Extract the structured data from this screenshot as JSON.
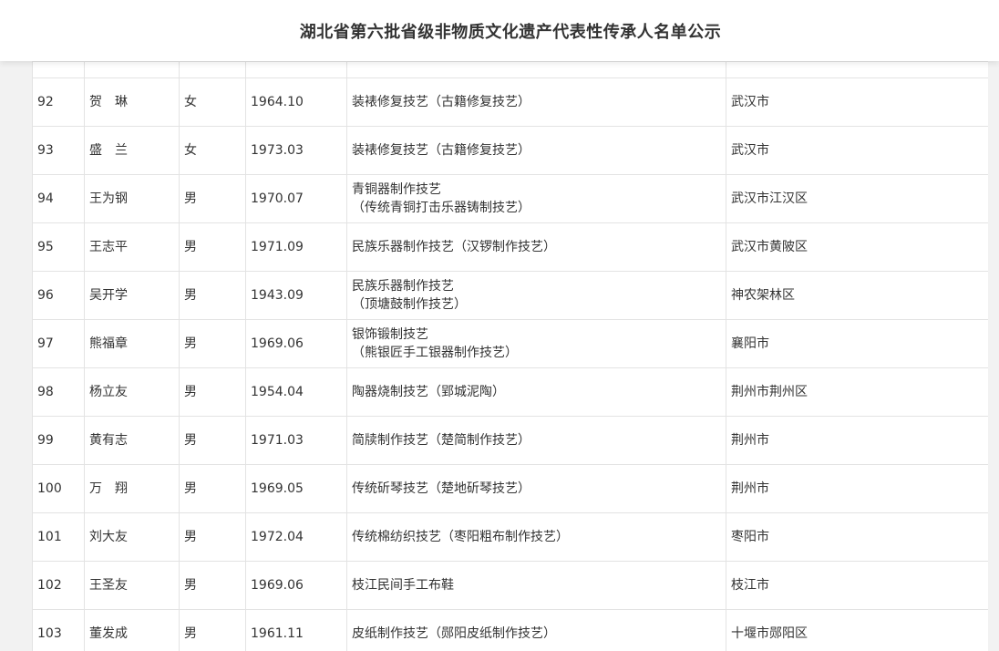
{
  "title": "湖北省第六批省级非物质文化遗产代表性传承人名单公示",
  "rows": [
    {
      "no": "92",
      "name": "贺　琳",
      "gender": "女",
      "birth": "1964.10",
      "project": [
        "装裱修复技艺（古籍修复技艺）"
      ],
      "region": "武汉市"
    },
    {
      "no": "93",
      "name": "盛　兰",
      "gender": "女",
      "birth": "1973.03",
      "project": [
        "装裱修复技艺（古籍修复技艺）"
      ],
      "region": "武汉市"
    },
    {
      "no": "94",
      "name": "王为钢",
      "gender": "男",
      "birth": "1970.07",
      "project": [
        "青铜器制作技艺",
        "（传统青铜打击乐器铸制技艺）"
      ],
      "region": "武汉市江汉区"
    },
    {
      "no": "95",
      "name": "王志平",
      "gender": "男",
      "birth": "1971.09",
      "project": [
        "民族乐器制作技艺（汉锣制作技艺）"
      ],
      "region": "武汉市黄陂区"
    },
    {
      "no": "96",
      "name": "吴开学",
      "gender": "男",
      "birth": "1943.09",
      "project": [
        "民族乐器制作技艺",
        "（顶塘鼓制作技艺）"
      ],
      "region": "神农架林区"
    },
    {
      "no": "97",
      "name": "熊福章",
      "gender": "男",
      "birth": "1969.06",
      "project": [
        "银饰锻制技艺",
        "（熊银匠手工银器制作技艺）"
      ],
      "region": "襄阳市"
    },
    {
      "no": "98",
      "name": "杨立友",
      "gender": "男",
      "birth": "1954.04",
      "project": [
        "陶器烧制技艺（郢城泥陶）"
      ],
      "region": "荆州市荆州区"
    },
    {
      "no": "99",
      "name": "黄有志",
      "gender": "男",
      "birth": "1971.03",
      "project": [
        "简牍制作技艺（楚简制作技艺）"
      ],
      "region": "荆州市"
    },
    {
      "no": "100",
      "name": "万　翔",
      "gender": "男",
      "birth": "1969.05",
      "project": [
        "传统斫琴技艺（楚地斫琴技艺）"
      ],
      "region": "荆州市"
    },
    {
      "no": "101",
      "name": "刘大友",
      "gender": "男",
      "birth": "1972.04",
      "project": [
        "传统棉纺织技艺（枣阳粗布制作技艺）"
      ],
      "region": "枣阳市"
    },
    {
      "no": "102",
      "name": "王圣友",
      "gender": "男",
      "birth": "1969.06",
      "project": [
        "枝江民间手工布鞋"
      ],
      "region": "枝江市"
    },
    {
      "no": "103",
      "name": "董发成",
      "gender": "男",
      "birth": "1961.11",
      "project": [
        "皮纸制作技艺（郧阳皮纸制作技艺）"
      ],
      "region": "十堰市郧阳区"
    }
  ]
}
